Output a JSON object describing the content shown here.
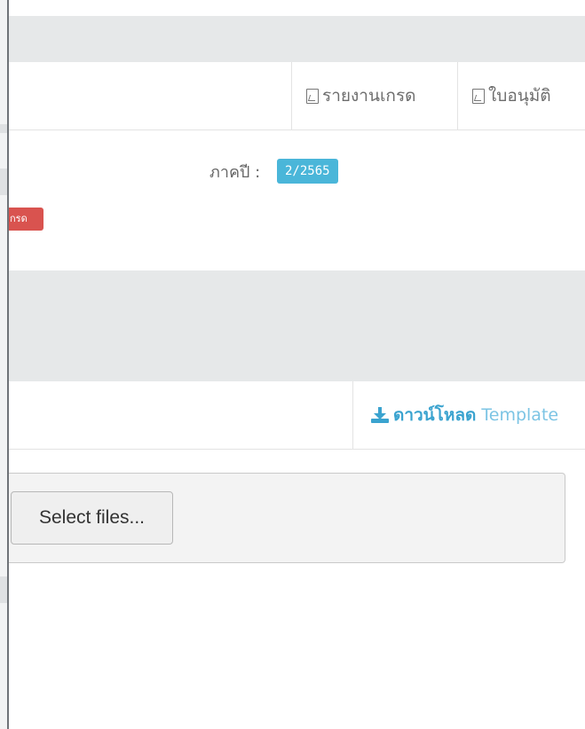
{
  "toolbar": {
    "grade_report_label": "รายงานเกรด",
    "approval_label": "ใบอนุมัติ"
  },
  "info": {
    "semester_label": "ภาคปี :",
    "semester_value": "2/2565",
    "grade_badge_text": "กรด"
  },
  "download": {
    "label_thai": "ดาวน์โหลด",
    "label_template": "Template"
  },
  "upload": {
    "select_files_label": "Select files..."
  },
  "colors": {
    "accent": "#4ab6d9",
    "danger": "#d9534f",
    "panel_gray": "#e6e8e9"
  },
  "icons": {
    "report": "pdf-file-icon",
    "approval": "pdf-file-icon",
    "download": "download-icon"
  }
}
